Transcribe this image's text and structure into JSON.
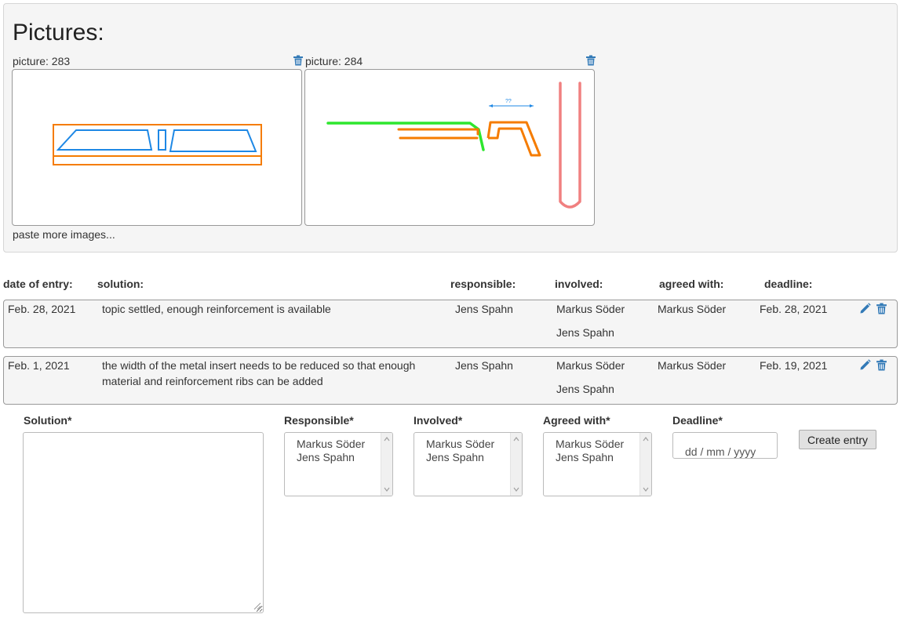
{
  "pictures": {
    "title": "Pictures:",
    "items": [
      {
        "label": "picture: 283"
      },
      {
        "label": "picture: 284"
      }
    ],
    "paste_more": "paste more images...",
    "sketch_2_annotation": "??"
  },
  "table": {
    "headers": {
      "date": "date of entry:",
      "solution": "solution:",
      "responsible": "responsible:",
      "involved": "involved:",
      "agreed": "agreed with:",
      "deadline": "deadline:"
    },
    "rows": [
      {
        "date": "Feb. 28, 2021",
        "solution": "topic settled, enough reinforcement is available",
        "responsible": "Jens Spahn",
        "involved": [
          "Markus Söder",
          "Jens Spahn"
        ],
        "agreed": "Markus Söder",
        "deadline": "Feb. 28, 2021"
      },
      {
        "date": "Feb. 1, 2021",
        "solution": "the width of the metal insert needs to be reduced so that enough material and reinforcement ribs can be added",
        "responsible": "Jens Spahn",
        "involved": [
          "Markus Söder",
          "Jens Spahn"
        ],
        "agreed": "Markus Söder",
        "deadline": "Feb. 19, 2021"
      }
    ]
  },
  "form": {
    "solution_label": "Solution*",
    "responsible_label": "Responsible*",
    "involved_label": "Involved*",
    "agreed_label": "Agreed with*",
    "deadline_label": "Deadline*",
    "options": [
      "Markus Söder",
      "Jens Spahn"
    ],
    "deadline_placeholder": "dd / mm / yyyy",
    "create_label": "Create entry"
  },
  "colors": {
    "icon_blue": "#337ab7",
    "sketch_blue": "#1e88e5",
    "sketch_orange": "#f57c00",
    "sketch_green": "#2ee62e",
    "sketch_pink": "#f08080"
  }
}
